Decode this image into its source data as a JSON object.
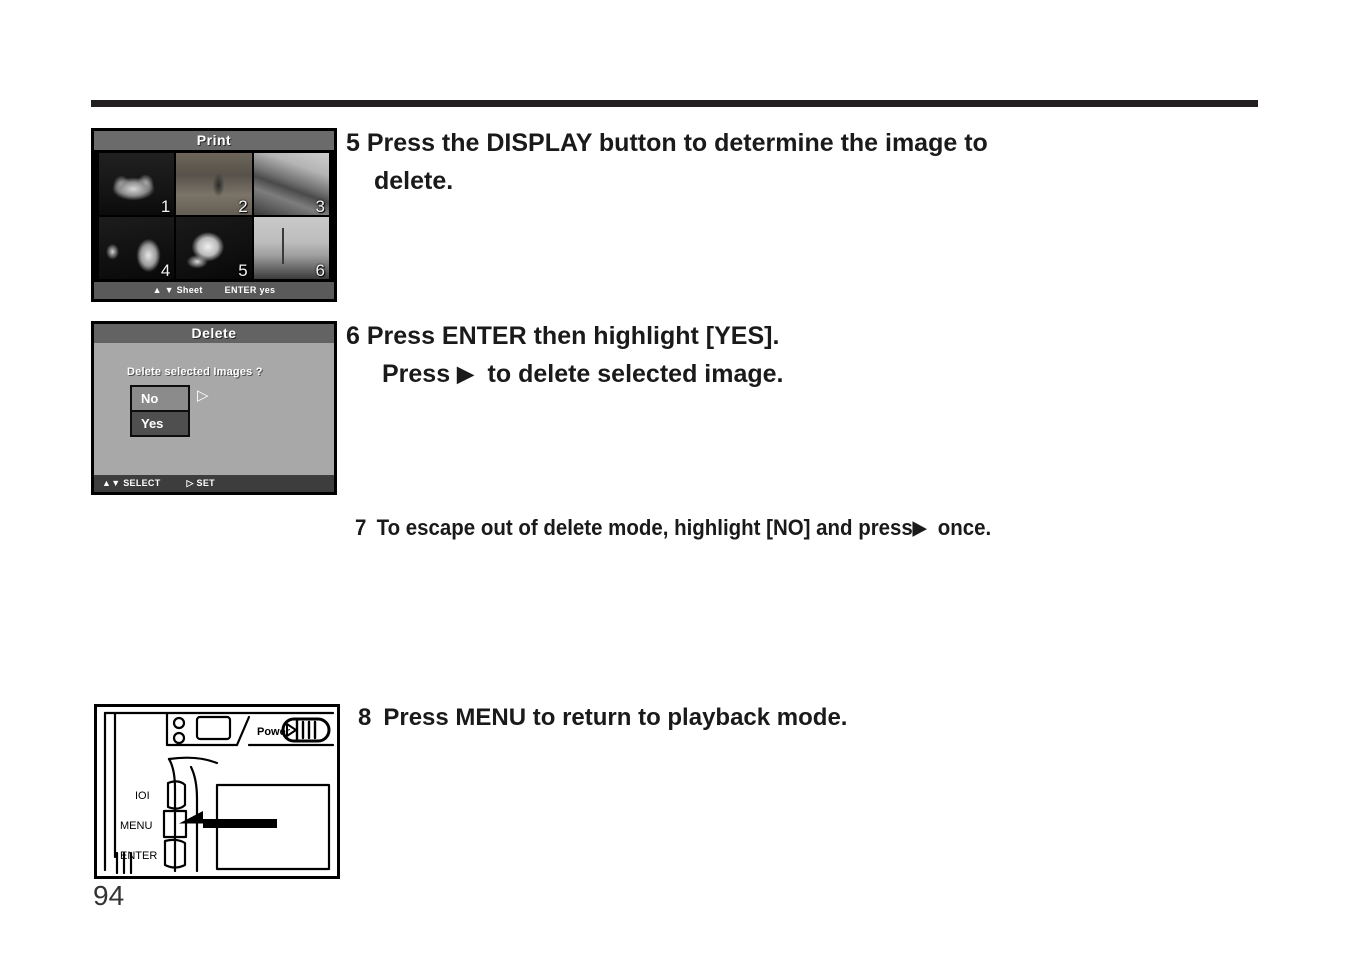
{
  "page": {
    "number": "94"
  },
  "print_screen": {
    "title": "Print",
    "thumbnails": [
      {
        "num": "1"
      },
      {
        "num": "2"
      },
      {
        "num": "3"
      },
      {
        "num": "4"
      },
      {
        "num": "5"
      },
      {
        "num": "6"
      }
    ],
    "footer": {
      "left": "▲ ▼ Sheet",
      "right": "ENTER yes"
    }
  },
  "delete_screen": {
    "title": "Delete",
    "question": "Delete selected Images ?",
    "choices": [
      {
        "label": "No",
        "selected": true
      },
      {
        "label": "Yes",
        "selected": false
      }
    ],
    "cursor_icon": "▷",
    "footer": {
      "left": "▲▼  SELECT",
      "right": "▷ SET"
    }
  },
  "steps": {
    "step5": {
      "num": "5",
      "line1": "Press the DISPLAY button to determine the image to",
      "line2": "delete."
    },
    "step6": {
      "num": "6",
      "line1": "Press ENTER then highlight [YES].",
      "line2_pre": "Press",
      "line2_arrow": "▶",
      "line2_post": "to delete selected image."
    },
    "step7": {
      "num": "7",
      "pre": "To escape out of delete mode, highlight [NO] and press",
      "arrow": "▶",
      "post": "once."
    },
    "step8": {
      "num": "8",
      "text": "Press MENU to return to playback mode."
    }
  },
  "camera": {
    "power_label": "Power",
    "power_icon": "play-triangle",
    "display_label": "IOI",
    "menu_label": "MENU",
    "enter_label": "ENTER",
    "callout_icon": "left-arrow"
  },
  "colors": {
    "rule": "#231f20",
    "lcd_bg": "#a8a8a8",
    "lcd_title_bar": "#636363",
    "lcd_footer_dark": "#3d3d3d",
    "choice_selected": "#8b8b8b",
    "choice_unselected": "#4f4f4f",
    "text": "#1a1a1a"
  }
}
